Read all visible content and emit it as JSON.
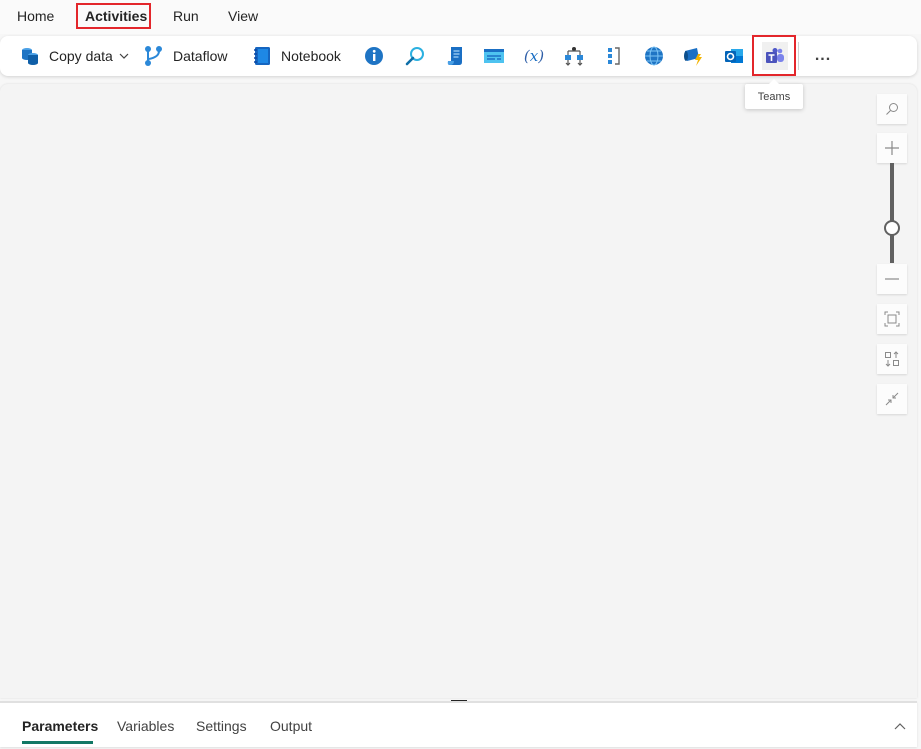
{
  "nav": {
    "tabs": [
      {
        "label": "Home"
      },
      {
        "label": "Activities",
        "active": true
      },
      {
        "label": "Run"
      },
      {
        "label": "View"
      }
    ]
  },
  "toolbar": {
    "copy_data": "Copy data",
    "dataflow": "Dataflow",
    "notebook": "Notebook",
    "icon_buttons": [
      "get-metadata-icon",
      "lookup-icon",
      "script-icon",
      "stored-procedure-icon",
      "set-variable-icon",
      "switch-icon",
      "filter-icon",
      "web-icon",
      "azure-function-icon",
      "outlook-icon",
      "teams-icon"
    ],
    "more": "..."
  },
  "tooltip": {
    "text": "Teams"
  },
  "zoom_controls": {
    "slider_level": 0.65
  },
  "bottom_panel": {
    "tabs": [
      {
        "label": "Parameters",
        "active": true
      },
      {
        "label": "Variables"
      },
      {
        "label": "Settings"
      },
      {
        "label": "Output"
      }
    ]
  },
  "colors": {
    "accent": "#117865",
    "highlight": "#e3262b"
  }
}
